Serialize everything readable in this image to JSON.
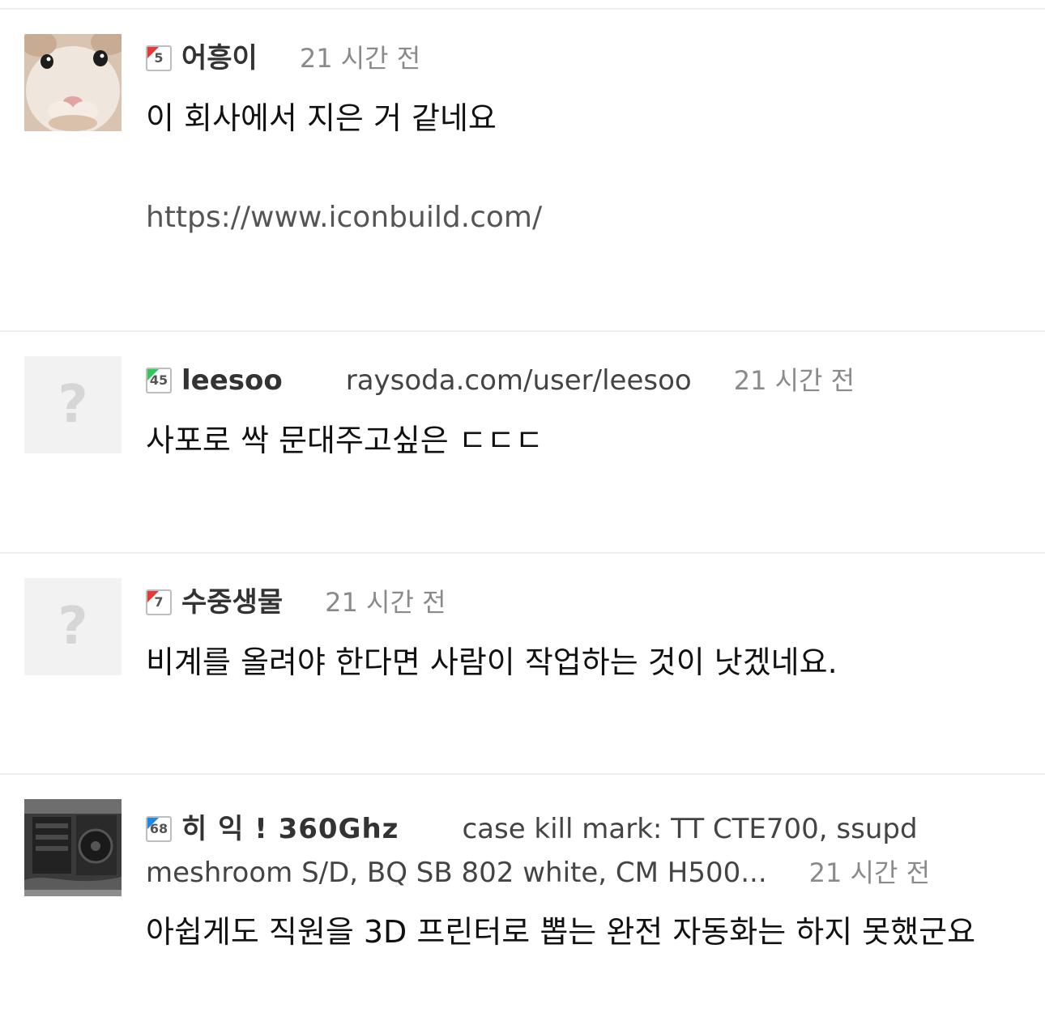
{
  "comments": [
    {
      "avatar": "hamster-avatar",
      "level": "5",
      "author": "어흥이",
      "time": "21 시간 전",
      "text": "이 회사에서 지은 거 같네요",
      "link": "https://www.iconbuild.com/"
    },
    {
      "avatar": "placeholder",
      "avatar_glyph": "?",
      "level": "45",
      "author": "leesoo",
      "site": "raysoda.com/user/leesoo",
      "time": "21 시간 전",
      "text": "사포로 싹 문대주고싶은 ㄷㄷㄷ"
    },
    {
      "avatar": "placeholder",
      "avatar_glyph": "?",
      "level": "7",
      "author": "수중생물",
      "time": "21 시간 전",
      "text": "비계를 올려야 한다면 사람이 작업하는 것이 낫겠네요."
    },
    {
      "avatar": "pc-case-avatar",
      "level": "68",
      "author": "히 익 ! 360Ghz",
      "site_line1": "case kill mark: TT CTE700, ssupd",
      "site_line2": "meshroom S/D, BQ SB 802 white, CM H500...",
      "time": "21 시간 전",
      "text": "아쉽게도 직원을 3D 프린터로 뽑는 완전 자동화는 하지 못했군요"
    }
  ],
  "colors": {
    "level_new": "#e53935",
    "level_mid": "#34c759",
    "level_high": "#1e88e5",
    "meta_gray": "#8a8a8a"
  }
}
